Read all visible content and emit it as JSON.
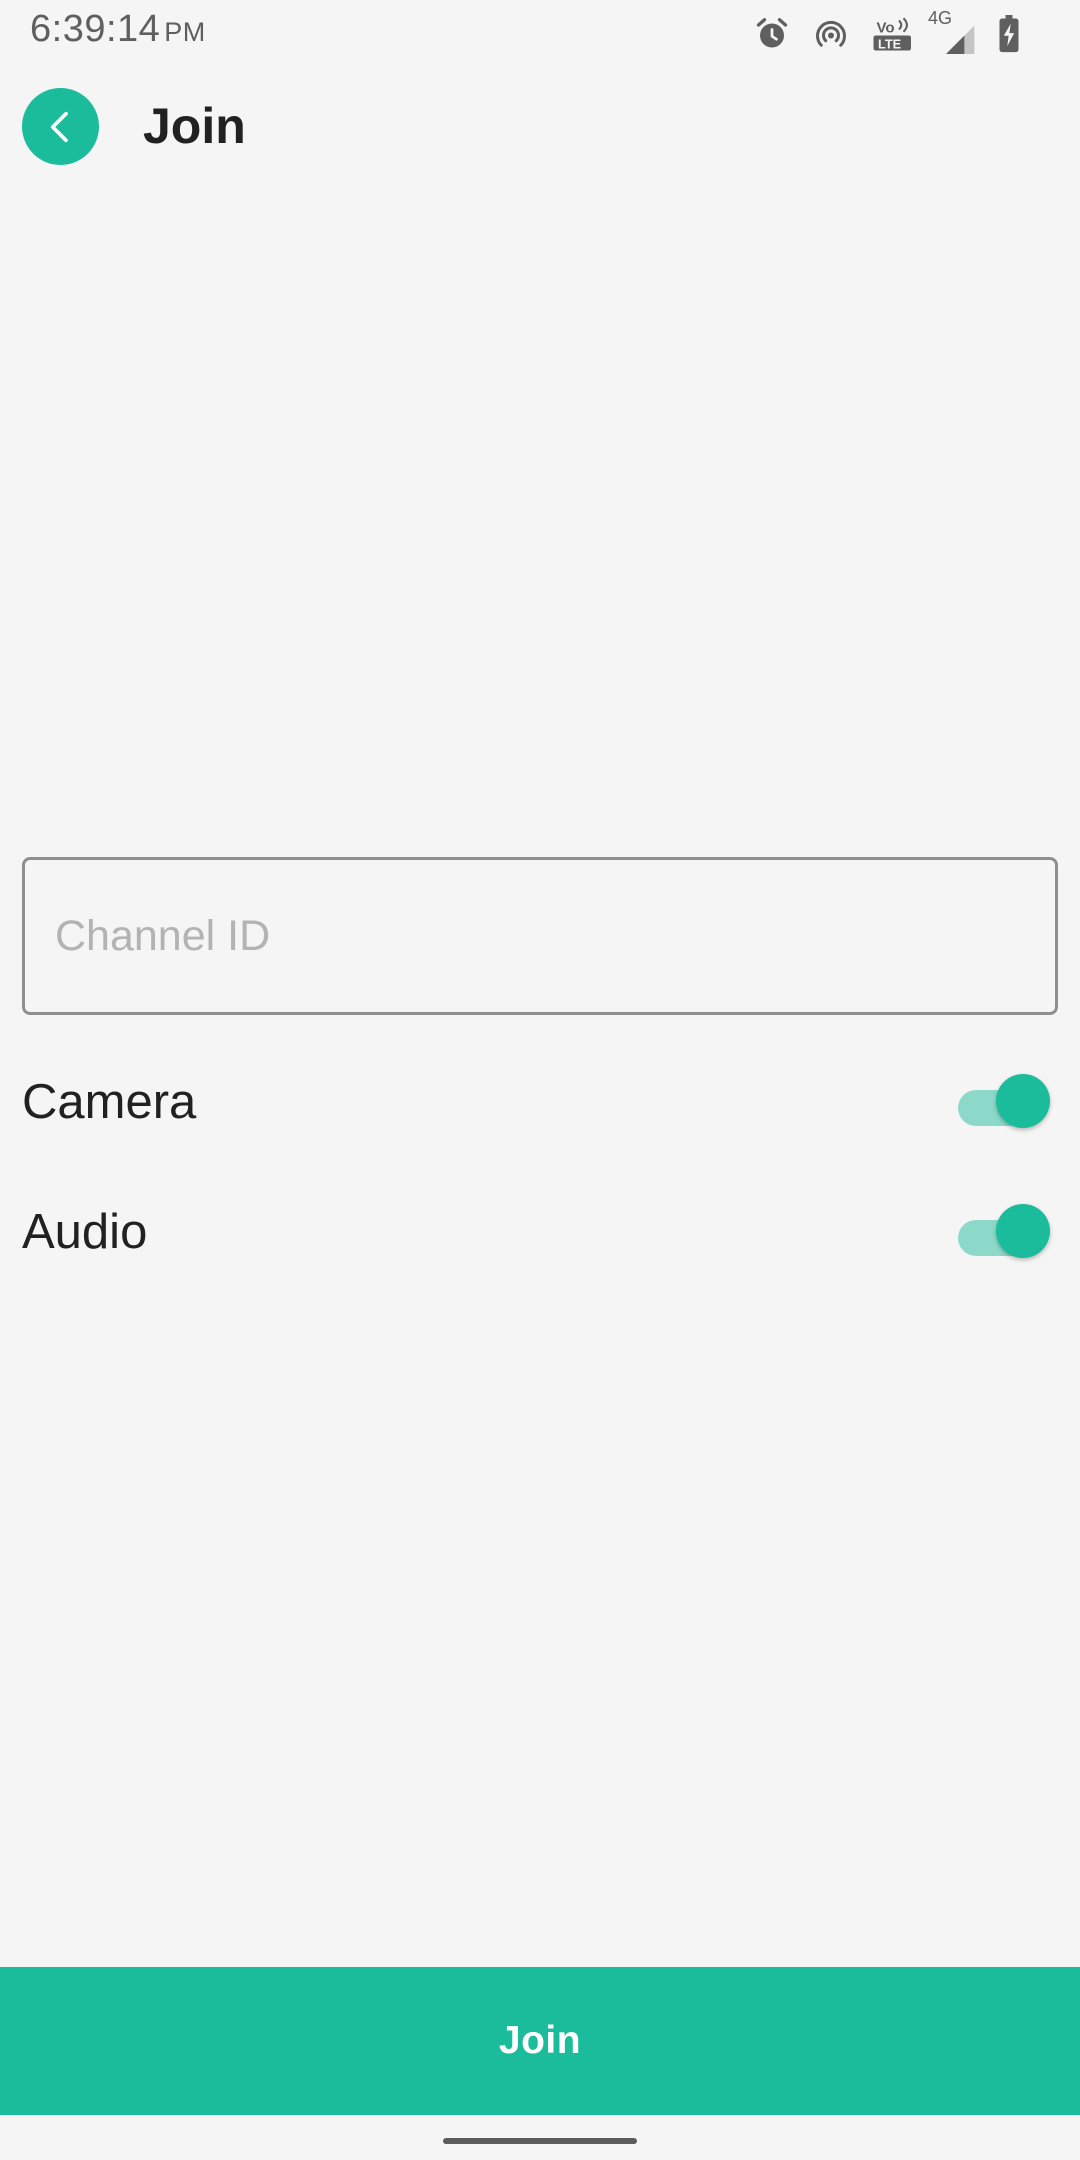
{
  "status_bar": {
    "time": "6:39:14",
    "ampm": "PM",
    "network_label": "4G",
    "icons": [
      "alarm-icon",
      "hotspot-icon",
      "volte-icon",
      "signal-icon",
      "battery-charging-icon"
    ]
  },
  "app_bar": {
    "title": "Join",
    "back_icon": "chevron-left-icon"
  },
  "form": {
    "channel_id": {
      "placeholder": "Channel ID",
      "value": ""
    },
    "toggles": [
      {
        "label": "Camera",
        "checked": true
      },
      {
        "label": "Audio",
        "checked": true
      }
    ]
  },
  "join_button": {
    "label": "Join"
  },
  "colors": {
    "accent": "#1bbc9b",
    "track": "#8dd9c9",
    "background": "#f5f5f5"
  }
}
